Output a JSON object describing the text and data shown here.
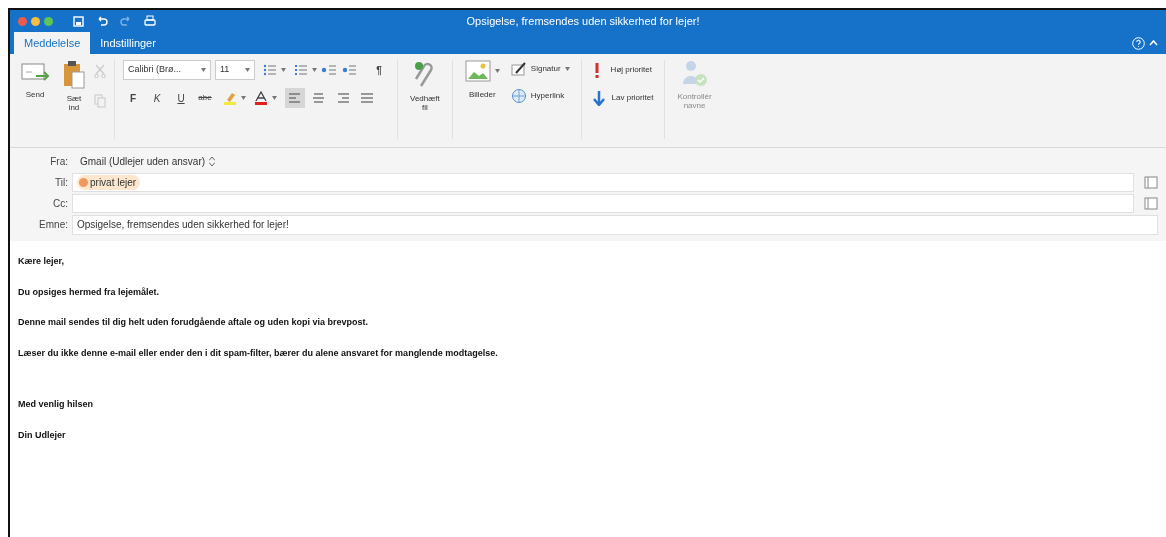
{
  "window": {
    "title": "Opsigelse, fremsendes uden sikkerhed for lejer!"
  },
  "tabs": [
    {
      "label": "Meddelelse",
      "selected": true
    },
    {
      "label": "Indstillinger",
      "selected": false
    }
  ],
  "ribbon": {
    "send": {
      "label": "Send"
    },
    "paste": {
      "label": "Sæt ind"
    },
    "clipboard": [
      {
        "kind": "cut",
        "disabled": true
      },
      {
        "kind": "copy",
        "disabled": true
      }
    ],
    "font": {
      "name": "Calibri (Brø...",
      "size": "11"
    },
    "pilcrow": "¶",
    "format_buttons": [
      {
        "kind": "bold",
        "label": "F"
      },
      {
        "kind": "italic",
        "label": "K"
      },
      {
        "kind": "underline",
        "label": "U"
      },
      {
        "kind": "strike",
        "label": "abe"
      }
    ],
    "align": [
      {
        "kind": "left",
        "selected": true
      },
      {
        "kind": "center",
        "selected": false
      },
      {
        "kind": "right",
        "selected": false
      },
      {
        "kind": "justify",
        "selected": false
      }
    ],
    "attach": {
      "label": "Vedhæft fil"
    },
    "pictures": {
      "label": "Billeder"
    },
    "signature": {
      "label": "Signatur"
    },
    "hyperlink": {
      "label": "Hyperlink"
    },
    "high_priority": {
      "label": "Høj prioritet"
    },
    "low_priority": {
      "label": "Lav prioritet"
    },
    "check_names": {
      "label": "Kontrollér navne",
      "disabled": true
    }
  },
  "header": {
    "from": {
      "label": "Fra:",
      "value": "Gmail (Udlejer uden ansvar)"
    },
    "to": {
      "label": "Til:",
      "recipients": [
        "privat lejer"
      ]
    },
    "cc": {
      "label": "Cc:"
    },
    "subject": {
      "label": "Emne:",
      "value": "Opsigelse, fremsendes uden sikkerhed for lejer!"
    }
  },
  "body": {
    "paragraphs": [
      "Kære lejer,",
      "Du opsiges hermed fra lejemålet.",
      "Denne mail sendes til dig helt uden forudgående aftale og uden kopi via brevpost.",
      "Læser du ikke denne e-mail eller ender den i dit spam-filter, bærer du alene ansvaret for manglende modtagelse."
    ],
    "closing": [
      "Med venlig hilsen",
      "Din Udlejer"
    ]
  }
}
